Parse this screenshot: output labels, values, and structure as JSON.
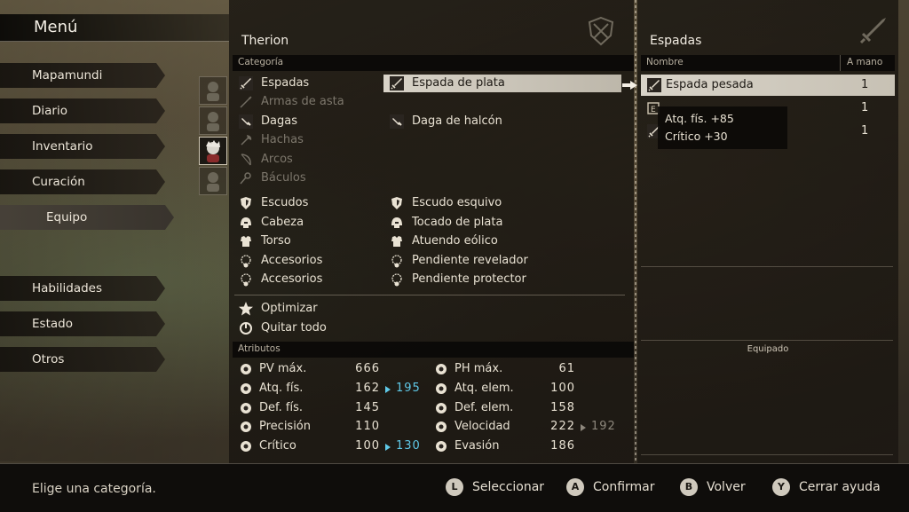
{
  "menu": {
    "title": "Menú",
    "items": [
      {
        "label": "Mapamundi"
      },
      {
        "label": "Diario"
      },
      {
        "label": "Inventario"
      },
      {
        "label": "Curación"
      },
      {
        "label": "Equipo"
      },
      {
        "label": "Habilidades"
      },
      {
        "label": "Estado"
      },
      {
        "label": "Otros"
      }
    ]
  },
  "character": {
    "name": "Therion"
  },
  "category": {
    "header": "Categoría",
    "items": [
      {
        "label": "Espadas",
        "icon": "sword-icon",
        "equipped": "Espada de plata",
        "equipped_icon": "sword-icon"
      },
      {
        "label": "Armas de asta",
        "icon": "spear-icon",
        "equipped": ""
      },
      {
        "label": "Dagas",
        "icon": "dagger-icon",
        "equipped": "Daga de halcón",
        "equipped_icon": "dagger-icon"
      },
      {
        "label": "Hachas",
        "icon": "axe-icon",
        "equipped": ""
      },
      {
        "label": "Arcos",
        "icon": "bow-icon",
        "equipped": ""
      },
      {
        "label": "Báculos",
        "icon": "staff-icon",
        "equipped": ""
      },
      {
        "label": "Escudos",
        "icon": "shield-icon",
        "equipped": "Escudo esquivo",
        "equipped_icon": "shield-icon"
      },
      {
        "label": "Cabeza",
        "icon": "helmet-icon",
        "equipped": "Tocado de plata",
        "equipped_icon": "helmet-icon"
      },
      {
        "label": "Torso",
        "icon": "armor-icon",
        "equipped": "Atuendo eólico",
        "equipped_icon": "armor-icon"
      },
      {
        "label": "Accesorios",
        "icon": "necklace-icon",
        "equipped": "Pendiente revelador",
        "equipped_icon": "necklace-icon"
      },
      {
        "label": "Accesorios",
        "icon": "necklace-icon",
        "equipped": "Pendiente protector",
        "equipped_icon": "necklace-icon"
      }
    ],
    "actions": [
      {
        "label": "Optimizar",
        "icon": "star-icon"
      },
      {
        "label": "Quitar todo",
        "icon": "remove-all-icon"
      }
    ]
  },
  "attributes": {
    "header": "Atributos",
    "left": [
      {
        "name": "PV máx.",
        "value": "666",
        "new": "",
        "icon": "heart-icon"
      },
      {
        "name": "Atq. fís.",
        "value": "162",
        "new": "195",
        "dir": "up",
        "icon": "fist-icon"
      },
      {
        "name": "Def. fís.",
        "value": "145",
        "new": "",
        "icon": "defense-icon"
      },
      {
        "name": "Precisión",
        "value": "110",
        "new": "",
        "icon": "target-icon"
      },
      {
        "name": "Crítico",
        "value": "100",
        "new": "130",
        "dir": "up",
        "icon": "critical-icon"
      }
    ],
    "right": [
      {
        "name": "PH máx.",
        "value": "61",
        "new": "",
        "icon": "flask-icon"
      },
      {
        "name": "Atq. elem.",
        "value": "100",
        "new": "",
        "icon": "elem-attack-icon"
      },
      {
        "name": "Def. elem.",
        "value": "158",
        "new": "",
        "icon": "elem-defense-icon"
      },
      {
        "name": "Velocidad",
        "value": "222",
        "new": "192",
        "dir": "down",
        "icon": "boot-icon"
      },
      {
        "name": "Evasión",
        "value": "186",
        "new": "",
        "icon": "evasion-icon"
      }
    ]
  },
  "weapons": {
    "title": "Espadas",
    "col_name": "Nombre",
    "col_count": "A mano",
    "rows": [
      {
        "label": "Espada pesada",
        "count": "1"
      },
      {
        "label": "",
        "count": "1"
      },
      {
        "label": "",
        "count": "1"
      }
    ],
    "tooltip": {
      "line1": "Atq. fís. +85",
      "line2": "Crítico +30"
    },
    "equipped_label": "Equipado"
  },
  "footer": {
    "help": "Elige una categoría.",
    "buttons": [
      {
        "key": "L",
        "label": "Seleccionar"
      },
      {
        "key": "A",
        "label": "Confirmar"
      },
      {
        "key": "B",
        "label": "Volver"
      },
      {
        "key": "Y",
        "label": "Cerrar ayuda"
      }
    ]
  },
  "colors": {
    "stat_up": "#5fc9e8",
    "stat_down": "#8d877c",
    "highlight": "#d8d3c8"
  }
}
